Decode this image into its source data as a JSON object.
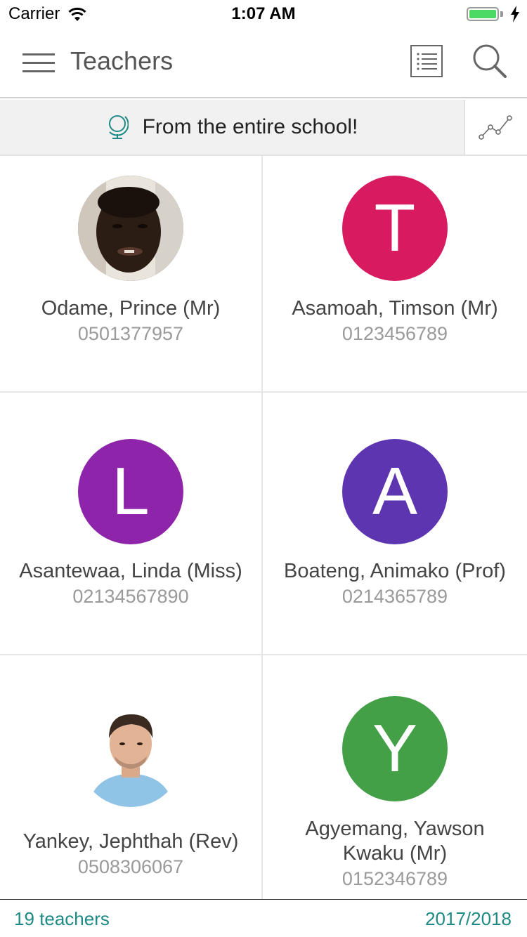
{
  "status_bar": {
    "carrier": "Carrier",
    "time": "1:07 AM"
  },
  "nav": {
    "title": "Teachers"
  },
  "filter": {
    "label": "From the entire school!"
  },
  "teachers": [
    {
      "name": "Odame, Prince (Mr)",
      "phone": "0501377957",
      "avatar": "photo"
    },
    {
      "name": "Asamoah, Timson (Mr)",
      "phone": "0123456789",
      "initial": "T",
      "color": "#d81b60"
    },
    {
      "name": "Asantewaa, Linda (Miss)",
      "phone": "02134567890",
      "initial": "L",
      "color": "#8e24aa"
    },
    {
      "name": "Boateng, Animako (Prof)",
      "phone": "0214365789",
      "initial": "A",
      "color": "#5e35b1"
    },
    {
      "name": "Yankey, Jephthah (Rev)",
      "phone": "0508306067",
      "avatar": "photo"
    },
    {
      "name": "Agyemang, Yawson Kwaku (Mr)",
      "phone": "0152346789",
      "initial": "Y",
      "color": "#43a047"
    }
  ],
  "footer": {
    "count": "19 teachers",
    "year": "2017/2018"
  },
  "colors": {
    "accent": "#1d8a84",
    "battery": "#4cd964"
  }
}
